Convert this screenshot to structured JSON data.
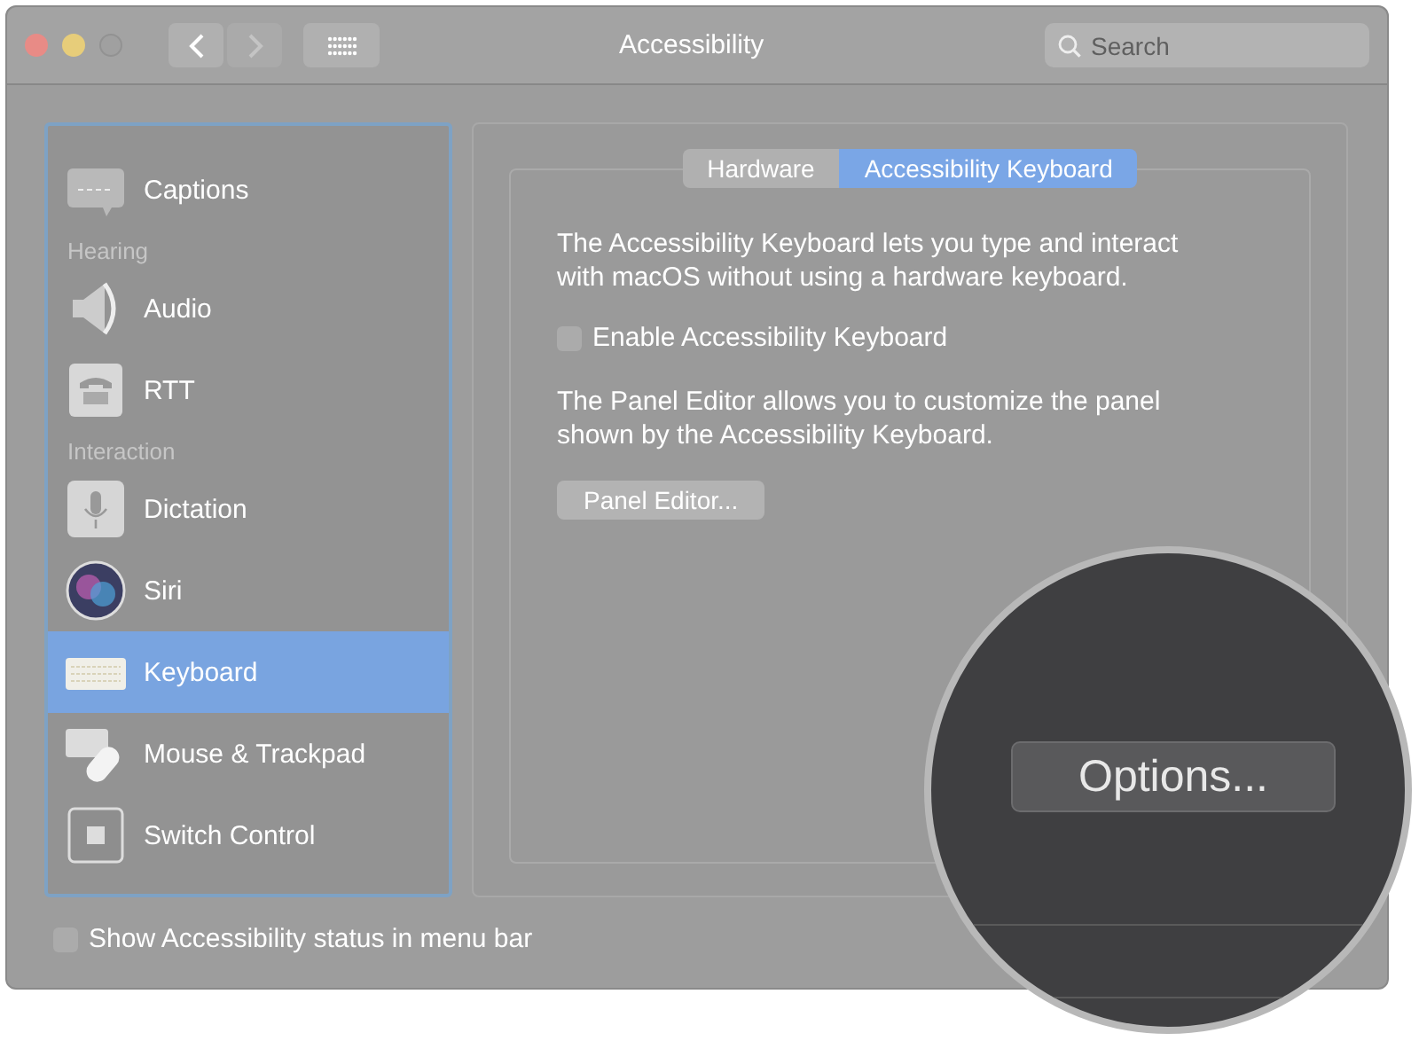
{
  "window": {
    "title": "Accessibility",
    "search": {
      "placeholder": "Search"
    }
  },
  "sidebar": {
    "items": [
      {
        "kind": "item",
        "label": "Captions",
        "selected": false
      },
      {
        "kind": "header",
        "label": "Hearing"
      },
      {
        "kind": "item",
        "label": "Audio",
        "selected": false
      },
      {
        "kind": "item",
        "label": "RTT",
        "selected": false
      },
      {
        "kind": "header",
        "label": "Interaction"
      },
      {
        "kind": "item",
        "label": "Dictation",
        "selected": false
      },
      {
        "kind": "item",
        "label": "Siri",
        "selected": false
      },
      {
        "kind": "item",
        "label": "Keyboard",
        "selected": true
      },
      {
        "kind": "item",
        "label": "Mouse & Trackpad",
        "selected": false
      },
      {
        "kind": "item",
        "label": "Switch Control",
        "selected": false
      }
    ]
  },
  "tabs": [
    {
      "label": "Hardware",
      "selected": false
    },
    {
      "label": "Accessibility Keyboard",
      "selected": true
    }
  ],
  "panel": {
    "intro": "The Accessibility Keyboard lets you type and interact with macOS without using a hardware keyboard.",
    "enable": {
      "label": "Enable Accessibility Keyboard",
      "checked": false
    },
    "editor_text": "The Panel Editor allows you to customize the panel shown by the Accessibility Keyboard.",
    "editor_button": "Panel Editor..."
  },
  "status_option": {
    "label": "Show Accessibility status in menu bar",
    "checked": false
  },
  "magnifier": {
    "button": "Options..."
  }
}
